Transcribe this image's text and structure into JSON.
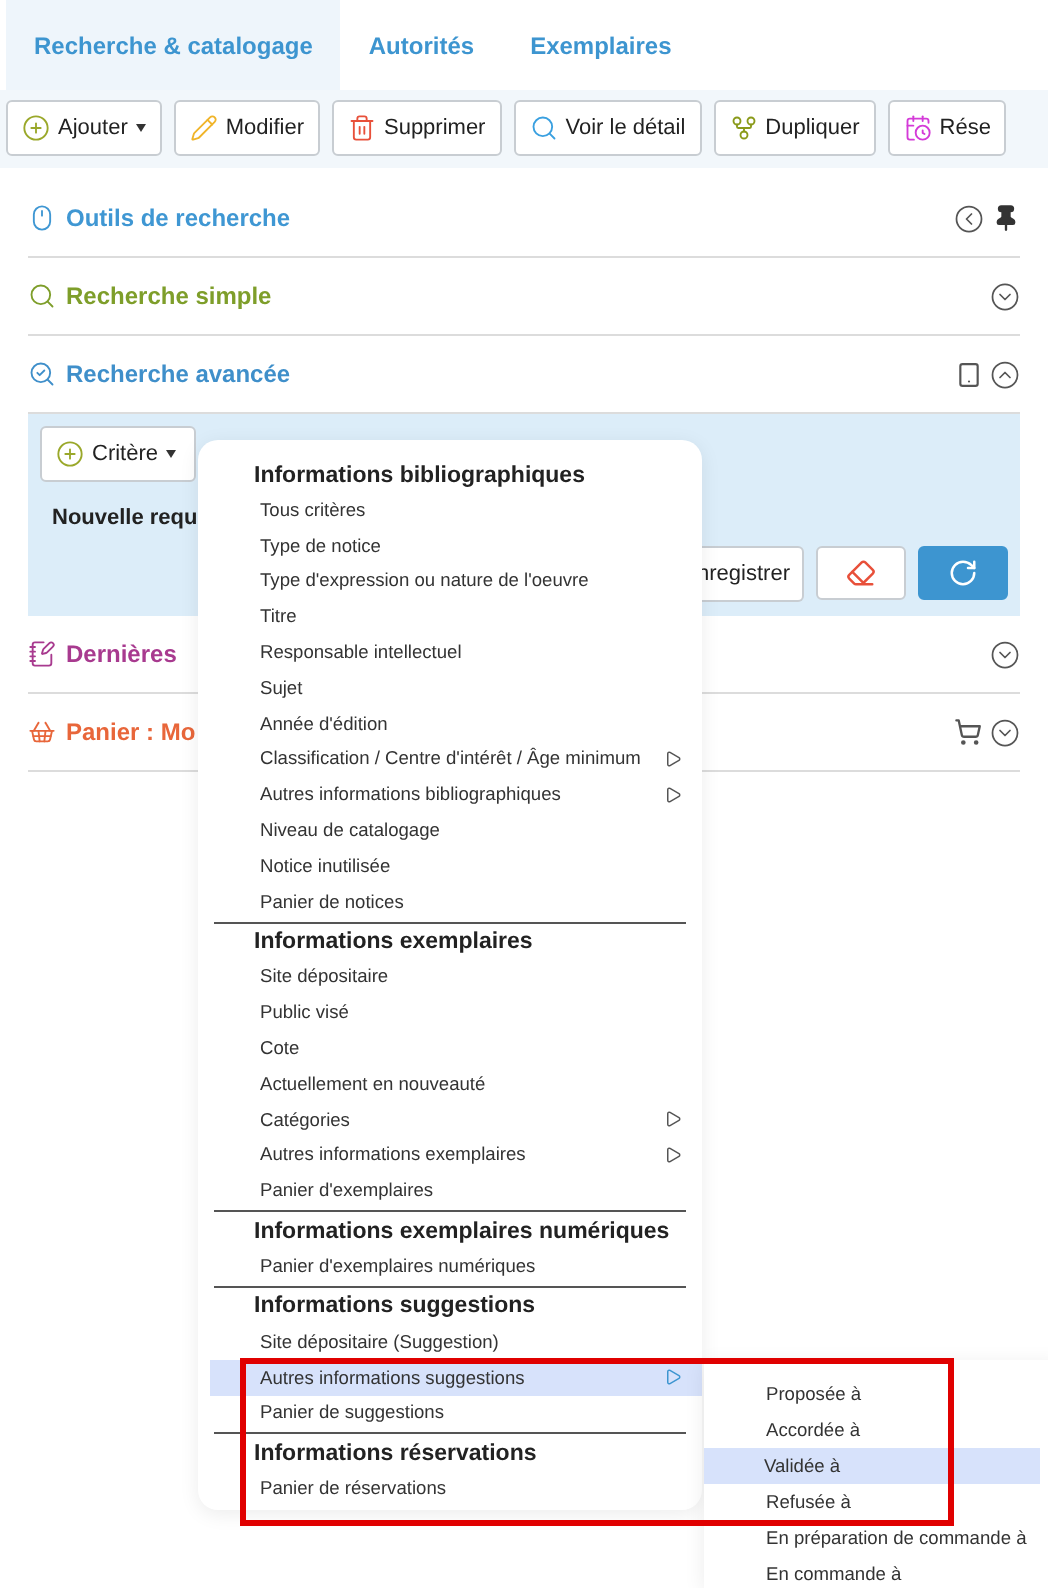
{
  "tabs": [
    {
      "label": "Recherche & catalogage",
      "selected": true
    },
    {
      "label": "Autorités",
      "selected": false
    },
    {
      "label": "Exemplaires",
      "selected": false
    }
  ],
  "toolbar": [
    {
      "label": "Ajouter",
      "dropdown": true,
      "color": "#9aa82a"
    },
    {
      "label": "Modifier",
      "dropdown": false,
      "color": "#f0b429"
    },
    {
      "label": "Supprimer",
      "dropdown": false,
      "color": "#e8503a"
    },
    {
      "label": "Voir le détail",
      "dropdown": false,
      "color": "#3aa0e0"
    },
    {
      "label": "Dupliquer",
      "dropdown": false,
      "color": "#8a9a1a"
    },
    {
      "label": "Rése",
      "dropdown": false,
      "color": "#d43ad8"
    }
  ],
  "sections": [
    {
      "title": "Outils de recherche",
      "kind": "tools",
      "color": "#3f97d3"
    },
    {
      "title": "Recherche simple",
      "kind": "panel",
      "color": "#7e9e2a",
      "expanded": false
    },
    {
      "title": "Recherche avancée",
      "kind": "panel",
      "color": "#3f8fca",
      "expanded": true
    },
    {
      "title": "Dernières",
      "kind": "panel",
      "color": "#a83a8f",
      "expanded": false
    },
    {
      "title": "Panier : Mo",
      "kind": "panel",
      "color": "#e8663a",
      "expanded": false
    }
  ],
  "advanced": {
    "criteria_button": "Critère",
    "query_label": "Nouvelle requ",
    "save_button": "nregistrer"
  },
  "menu": [
    {
      "header": "Informations bibliographiques",
      "items": [
        {
          "label": "Tous critères",
          "has_submenu": false,
          "selected": false
        },
        {
          "label": "Type de notice",
          "has_submenu": false,
          "selected": false
        },
        {
          "label": "Type d'expression ou nature de l'oeuvre",
          "has_submenu": false,
          "selected": false
        },
        {
          "label": "Titre",
          "has_submenu": false,
          "selected": false
        },
        {
          "label": "Responsable intellectuel",
          "has_submenu": false,
          "selected": false
        },
        {
          "label": "Sujet",
          "has_submenu": false,
          "selected": false
        },
        {
          "label": "Année d'édition",
          "has_submenu": false,
          "selected": false
        },
        {
          "label": "Classification / Centre d'intérêt / Âge minimum",
          "has_submenu": true,
          "selected": false
        },
        {
          "label": "Autres informations bibliographiques",
          "has_submenu": true,
          "selected": false
        },
        {
          "label": "Niveau de catalogage",
          "has_submenu": false,
          "selected": false
        },
        {
          "label": "Notice inutilisée",
          "has_submenu": false,
          "selected": false
        },
        {
          "label": "Panier de notices",
          "has_submenu": false,
          "selected": false
        }
      ]
    },
    {
      "header": "Informations exemplaires",
      "items": [
        {
          "label": "Site dépositaire",
          "has_submenu": false,
          "selected": false
        },
        {
          "label": "Public visé",
          "has_submenu": false,
          "selected": false
        },
        {
          "label": "Cote",
          "has_submenu": false,
          "selected": false
        },
        {
          "label": "Actuellement en nouveauté",
          "has_submenu": false,
          "selected": false
        },
        {
          "label": "Catégories",
          "has_submenu": true,
          "selected": false
        },
        {
          "label": "Autres informations exemplaires",
          "has_submenu": true,
          "selected": false
        },
        {
          "label": "Panier d'exemplaires",
          "has_submenu": false,
          "selected": false
        }
      ]
    },
    {
      "header": "Informations exemplaires numériques",
      "items": [
        {
          "label": "Panier d'exemplaires numériques",
          "has_submenu": false,
          "selected": false
        }
      ]
    },
    {
      "header": "Informations suggestions",
      "items": [
        {
          "label": "Site dépositaire (Suggestion)",
          "has_submenu": false,
          "selected": false
        },
        {
          "label": "Autres informations suggestions",
          "has_submenu": true,
          "selected": true
        },
        {
          "label": "Panier de suggestions",
          "has_submenu": false,
          "selected": false
        }
      ]
    },
    {
      "header": "Informations réservations",
      "items": [
        {
          "label": "Panier de réservations",
          "has_submenu": false,
          "selected": false
        }
      ]
    }
  ],
  "submenu": [
    {
      "label": "Proposée à",
      "selected": false
    },
    {
      "label": "Accordée à",
      "selected": false
    },
    {
      "label": "Validée à",
      "selected": true
    },
    {
      "label": "Refusée à",
      "selected": false
    },
    {
      "label": "En préparation de commande à",
      "selected": false
    },
    {
      "label": "En commande à",
      "selected": false
    }
  ]
}
